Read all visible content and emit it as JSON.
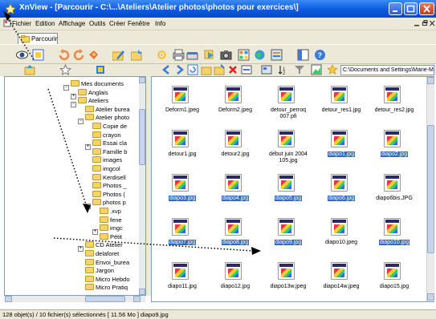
{
  "window": {
    "title": "XnView - [Parcourir - C:\\...\\Ateliers\\Atelier photos\\photos pour exercices\\]"
  },
  "menu": [
    "Fichier",
    "Edition",
    "Affichage",
    "Outils",
    "Créer",
    "Fenêtre",
    "Info"
  ],
  "tab": "Parcourir",
  "address": "C:\\Documents and Settings\\Marie-M",
  "tree": [
    {
      "label": "Mes documents",
      "level": 0
    },
    {
      "label": "Anglais",
      "level": 1
    },
    {
      "label": "Ateliers",
      "level": 1
    },
    {
      "label": "Atelier burea",
      "level": 2
    },
    {
      "label": "Atelier photo",
      "level": 2
    },
    {
      "label": "Copie de",
      "level": 3
    },
    {
      "label": "crayon",
      "level": 3
    },
    {
      "label": "Essai cla",
      "level": 3
    },
    {
      "label": "Famille b",
      "level": 3
    },
    {
      "label": "images",
      "level": 3
    },
    {
      "label": "imgcol",
      "level": 3
    },
    {
      "label": "Kerdisell",
      "level": 3
    },
    {
      "label": "Photos _",
      "level": 3
    },
    {
      "label": "Photos (",
      "level": 3
    },
    {
      "label": "photos p",
      "level": 3
    },
    {
      "label": ".xvp",
      "level": 4
    },
    {
      "label": "fene",
      "level": 4
    },
    {
      "label": "imgc",
      "level": 4
    },
    {
      "label": "Pétit",
      "level": 4
    },
    {
      "label": "CD Atelier",
      "level": 2
    },
    {
      "label": "delaforet",
      "level": 2
    },
    {
      "label": "Envoi_burea",
      "level": 2
    },
    {
      "label": "Jargon",
      "level": 2
    },
    {
      "label": "Micro Hebdo",
      "level": 2
    },
    {
      "label": "Micro Pratiq",
      "level": 2
    }
  ],
  "files": [
    {
      "name": "Deform1.jpeg",
      "sel": false
    },
    {
      "name": "Deform2.jpeg",
      "sel": false
    },
    {
      "name": "detour_perroq 007.pfi",
      "sel": false
    },
    {
      "name": "detour_res1.jpg",
      "sel": false
    },
    {
      "name": "detour_res2.jpg",
      "sel": false
    },
    {
      "name": "detour1.jpg",
      "sel": false
    },
    {
      "name": "detour2.jpg",
      "sel": false
    },
    {
      "name": "début juin 2004 105.jpg",
      "sel": false
    },
    {
      "name": "diapo1.jpg",
      "sel": true
    },
    {
      "name": "diapo2.jpg",
      "sel": true
    },
    {
      "name": "diapo3.jpg",
      "sel": true
    },
    {
      "name": "diapo4.jpg",
      "sel": true
    },
    {
      "name": "diapo5.jpg",
      "sel": true
    },
    {
      "name": "diapo6.jpg",
      "sel": true
    },
    {
      "name": "diapo6bis.JPG",
      "sel": false
    },
    {
      "name": "diapo7.jpg",
      "sel": true
    },
    {
      "name": "diapo8.jpg",
      "sel": true
    },
    {
      "name": "diapo9.jpg",
      "sel": true
    },
    {
      "name": "diapo10.jpeg",
      "sel": false
    },
    {
      "name": "diapo10.jpg",
      "sel": true
    },
    {
      "name": "diapo11.jpg",
      "sel": false
    },
    {
      "name": "diapo12.jpg",
      "sel": false
    },
    {
      "name": "diapo13w.jpeg",
      "sel": false
    },
    {
      "name": "diapo14w.jpeg",
      "sel": false
    },
    {
      "name": "diapo15.jpg",
      "sel": false
    }
  ],
  "status": "128 objet(s) / 10 fichier(s) sélectionnés  [ 11.56 Mo ]  diapo9.jpg"
}
